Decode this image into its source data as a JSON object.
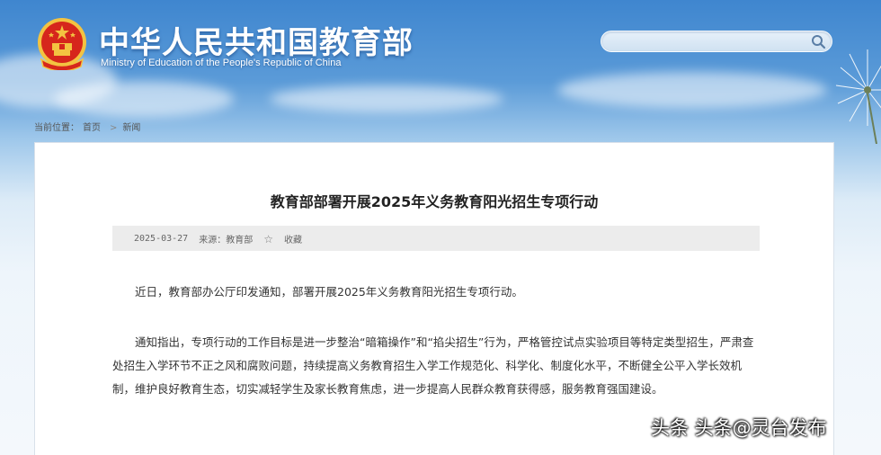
{
  "header": {
    "title_cn": "中华人民共和国教育部",
    "title_en": "Ministry of Education of the People's Republic of China",
    "search": {
      "value": "",
      "placeholder": ""
    }
  },
  "breadcrumb": {
    "label": "当前位置：",
    "items": [
      "首页",
      "新闻"
    ],
    "separator": ">"
  },
  "article": {
    "title": "教育部部署开展2025年义务教育阳光招生专项行动",
    "date": "2025-03-27",
    "source": "来源：教育部",
    "favorite_label": "收藏",
    "paragraphs": [
      "近日，教育部办公厅印发通知，部署开展2025年义务教育阳光招生专项行动。",
      "通知指出，专项行动的工作目标是进一步整治“暗箱操作”和“掐尖招生”行为，严格管控试点实验项目等特定类型招生，严肃查处招生入学环节不正之风和腐败问题，持续提高义务教育招生入学工作规范化、科学化、制度化水平，不断健全公平入学长效机制，维护良好教育生态，切实减轻学生及家长教育焦虑，进一步提高人民群众教育获得感，服务教育强国建设。"
    ]
  },
  "watermark": "头条 头条@灵台发布",
  "icons": {
    "search": "search-icon",
    "star": "star-icon",
    "emblem": "national-emblem-icon"
  },
  "colors": {
    "header_blue": "#3f86cf",
    "emblem_red": "#d6261c",
    "emblem_gold": "#f3c341"
  }
}
